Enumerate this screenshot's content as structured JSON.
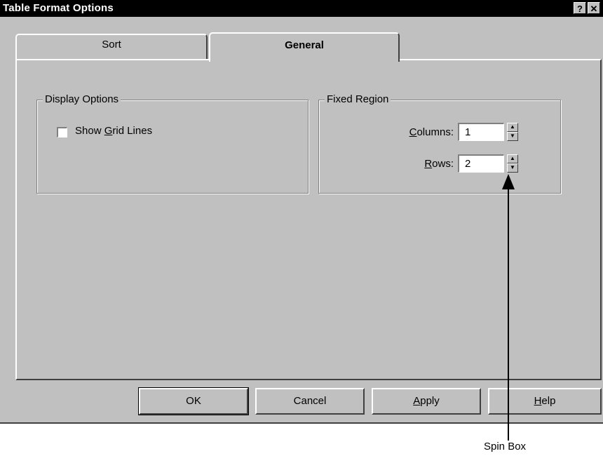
{
  "window": {
    "title": "Table Format Options",
    "help_btn": "?",
    "close_btn": "✕"
  },
  "tabs": [
    {
      "label": "Sort"
    },
    {
      "label": "General"
    }
  ],
  "display_options": {
    "title": "Display Options",
    "checkbox": {
      "pre": "Show ",
      "underlined": "G",
      "post": "rid Lines",
      "checked": false
    }
  },
  "fixed_region": {
    "title": "Fixed Region",
    "columns": {
      "underlined": "C",
      "rest": "olumns:",
      "value": "1"
    },
    "rows": {
      "underlined": "R",
      "rest": "ows:",
      "value": "2"
    }
  },
  "buttons": {
    "ok": "OK",
    "cancel": "Cancel",
    "apply": {
      "underlined": "A",
      "rest": "pply"
    },
    "help": {
      "underlined": "H",
      "rest": "elp"
    }
  },
  "annotation": {
    "label": "Spin Box"
  }
}
